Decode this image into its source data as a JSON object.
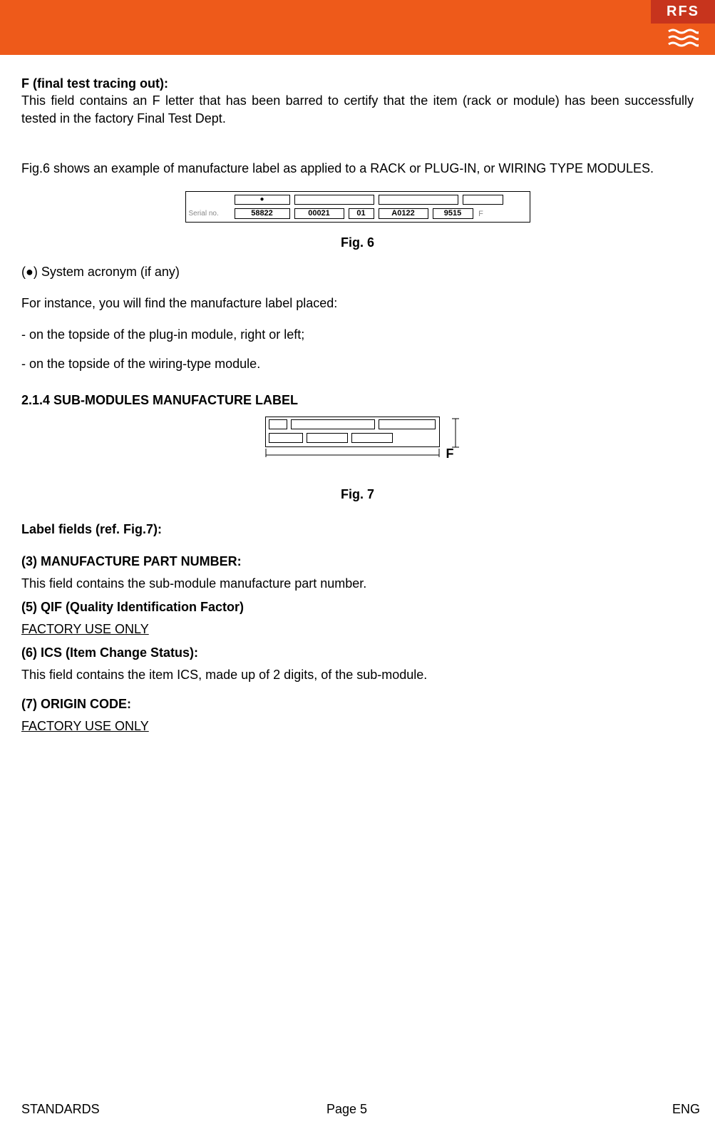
{
  "logo": {
    "text": "RFS"
  },
  "section_f": {
    "heading": "F (final test tracing out):",
    "body": "This field contains an F letter that has been barred to certify that the item (rack or module) has been successfully tested in the factory Final Test Dept."
  },
  "fig6_intro": "Fig.6 shows an example of manufacture label as applied to a RACK or PLUG-IN, or WIRING TYPE MODULES.",
  "fig6": {
    "serial_label": "Serial no.",
    "dot": "●",
    "cells": {
      "a": "58822",
      "b": "00021",
      "c": "01",
      "d": "A0122",
      "e": "9515"
    },
    "trailing": "F",
    "caption": "Fig. 6"
  },
  "acronym_note": "(●) System acronym (if any)",
  "placement_intro": "For instance, you will find the manufacture label placed:",
  "placement_items": [
    "- on the topside of the plug-in module, right or left;",
    "- on the topside of the wiring-type module."
  ],
  "section_214": "2.1.4 SUB-MODULES MANUFACTURE LABEL",
  "fig7": {
    "letter": "F",
    "caption": "Fig. 7"
  },
  "label_fields_heading": "Label fields (ref. Fig.7):",
  "fields": {
    "f3": {
      "heading": "(3) MANUFACTURE PART NUMBER:",
      "body": "This field contains the sub-module manufacture part number."
    },
    "f5": {
      "heading": "(5) QIF (Quality Identification Factor)",
      "body": "FACTORY USE ONLY"
    },
    "f6": {
      "heading": "(6) ICS (Item Change Status):",
      "body": "This field contains the item ICS, made up of 2 digits, of the sub-module."
    },
    "f7": {
      "heading": "(7) ORIGIN CODE:",
      "body": "FACTORY USE ONLY"
    }
  },
  "footer": {
    "left": "STANDARDS",
    "center": "Page 5",
    "right": "ENG"
  }
}
